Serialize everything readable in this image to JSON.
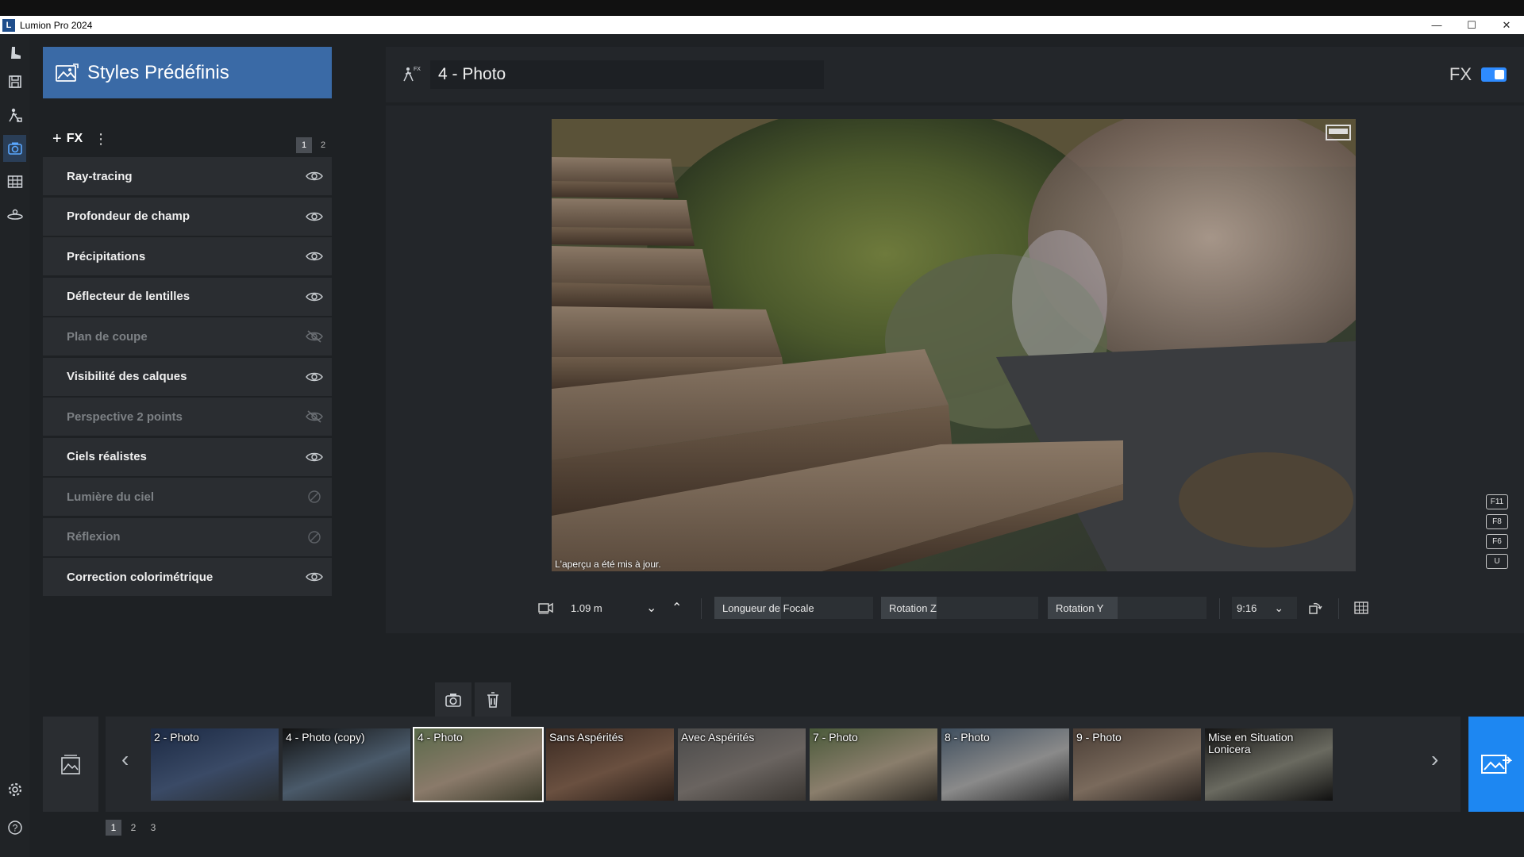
{
  "window": {
    "title": "Lumion Pro 2024",
    "logo_letter": "L",
    "controls": [
      "—",
      "☐",
      "✕"
    ]
  },
  "iconbar": {
    "items": [
      {
        "icon": "boot-icon",
        "glyph": "⛸"
      },
      {
        "icon": "save-icon",
        "glyph": "💾"
      },
      {
        "icon": "build-mode-icon",
        "glyph": "⛹"
      },
      {
        "icon": "photo-mode-icon",
        "glyph": "📷"
      },
      {
        "icon": "movie-mode-icon",
        "glyph": "🎞"
      },
      {
        "icon": "360-panorama-icon",
        "glyph": "⟲"
      },
      {
        "icon": "settings-icon",
        "glyph": "⚙"
      },
      {
        "icon": "help-icon",
        "glyph": "?"
      }
    ]
  },
  "panel": {
    "title": "Styles Prédéfinis",
    "fx_add_label": "FX",
    "fx_add_glyph": "+",
    "menu_glyph": "⋮",
    "pages": [
      "1",
      "2"
    ],
    "effects": [
      {
        "label": "Ray-tracing",
        "state": "visible"
      },
      {
        "label": "Profondeur de champ",
        "state": "visible"
      },
      {
        "label": "Précipitations",
        "state": "visible"
      },
      {
        "label": "Déflecteur de lentilles",
        "state": "visible"
      },
      {
        "label": "Plan de coupe",
        "state": "hidden"
      },
      {
        "label": "Visibilité des calques",
        "state": "visible"
      },
      {
        "label": "Perspective 2 points",
        "state": "hidden"
      },
      {
        "label": "Ciels réalistes",
        "state": "visible"
      },
      {
        "label": "Lumière du ciel",
        "state": "disabled"
      },
      {
        "label": "Réflexion",
        "state": "disabled"
      },
      {
        "label": "Correction colorimétrique",
        "state": "visible"
      }
    ]
  },
  "main": {
    "photo_name": "4 - Photo",
    "fx_label": "FX",
    "fx_toggle_on": true,
    "preview_status": "L'aperçu a été mis à jour.",
    "shortcut_keys": [
      "F11",
      "F8",
      "F6",
      "U"
    ]
  },
  "camera": {
    "height_value": "1.09 m",
    "focal_label": "Longueur de Focale",
    "rotation_z_label": "Rotation Z",
    "rotation_y_label": "Rotation Y",
    "aspect_ratio": "9:16"
  },
  "filmstrip": {
    "thumbnails": [
      {
        "label": "2 - Photo",
        "selected": false
      },
      {
        "label": "4 - Photo (copy)",
        "selected": false
      },
      {
        "label": "4 - Photo",
        "selected": true
      },
      {
        "label": "Sans Aspérités",
        "selected": false
      },
      {
        "label": "Avec Aspérités",
        "selected": false
      },
      {
        "label": "7 - Photo",
        "selected": false
      },
      {
        "label": "8 - Photo",
        "selected": false
      },
      {
        "label": "9 - Photo",
        "selected": false
      },
      {
        "label": "Mise en Situation Lonicera",
        "selected": false
      }
    ],
    "pages": [
      "1",
      "2",
      "3"
    ],
    "prev_glyph": "‹",
    "next_glyph": "›"
  },
  "colors": {
    "accent": "#1d87f2",
    "header": "#3a6aa6",
    "panel_item": "#2a2d31",
    "background": "#1e2124"
  }
}
